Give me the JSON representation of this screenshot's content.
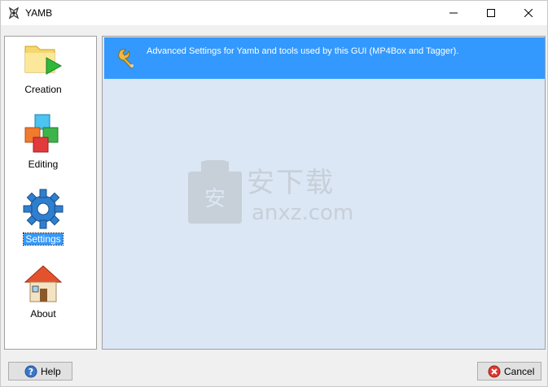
{
  "window": {
    "title": "YAMB"
  },
  "sidebar": {
    "items": [
      {
        "label": "Creation"
      },
      {
        "label": "Editing"
      },
      {
        "label": "Settings"
      },
      {
        "label": "About"
      }
    ]
  },
  "content": {
    "banner_text": "Advanced Settings for Yamb and tools used by this GUI (MP4Box and Tagger)."
  },
  "watermark": {
    "cn": "安下载",
    "en": "anxz.com",
    "shield_char": "安"
  },
  "footer": {
    "help_label": "Help",
    "cancel_label": "Cancel"
  },
  "colors": {
    "selection": "#3399ff",
    "content_bg": "#dbe7f5",
    "banner_bg": "#3399ff"
  }
}
